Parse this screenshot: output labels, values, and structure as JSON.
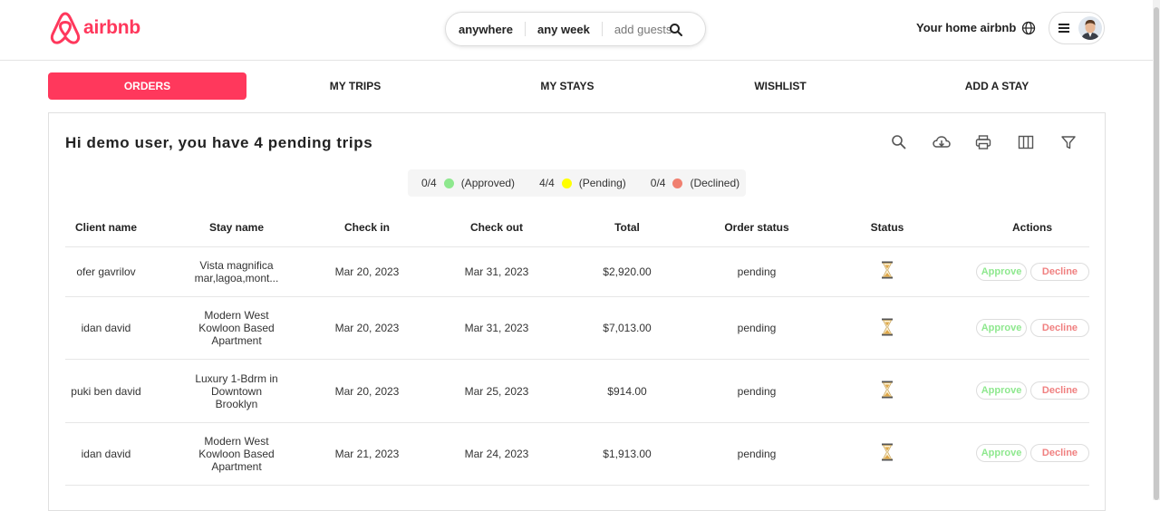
{
  "header": {
    "logo_text": "airbnb",
    "search": {
      "where": "anywhere",
      "when": "any week",
      "guests_placeholder": "add guests"
    },
    "host_link": "Your home airbnb"
  },
  "tabs": [
    {
      "label": "ORDERS",
      "active": true
    },
    {
      "label": "MY TRIPS",
      "active": false
    },
    {
      "label": "MY STAYS",
      "active": false
    },
    {
      "label": "WISHLIST",
      "active": false
    },
    {
      "label": "ADD A STAY",
      "active": false
    }
  ],
  "main": {
    "greeting": "Hi demo user, you have 4 pending trips",
    "toolbar_icons": [
      "search-icon",
      "cloud-download-icon",
      "print-icon",
      "columns-icon",
      "filter-icon"
    ],
    "summary": [
      {
        "count": "0/4",
        "label": "(Approved)",
        "color": "#8ee88e"
      },
      {
        "count": "4/4",
        "label": "(Pending)",
        "color": "#ffff00"
      },
      {
        "count": "0/4",
        "label": "(Declined)",
        "color": "#f08070"
      }
    ],
    "columns": [
      "Client name",
      "Stay name",
      "Check in",
      "Check out",
      "Total",
      "Order status",
      "Status",
      "Actions"
    ],
    "rows": [
      {
        "client": "ofer gavrilov",
        "stay": [
          "Vista magnifica",
          "mar,lagoa,mont..."
        ],
        "check_in": "Mar 20, 2023",
        "check_out": "Mar 31, 2023",
        "total": "$2,920.00",
        "order_status": "pending",
        "status_icon": "hourglass-icon"
      },
      {
        "client": "idan david",
        "stay": [
          "Modern West",
          "Kowloon Based",
          "Apartment"
        ],
        "check_in": "Mar 20, 2023",
        "check_out": "Mar 31, 2023",
        "total": "$7,013.00",
        "order_status": "pending",
        "status_icon": "hourglass-icon"
      },
      {
        "client": "puki ben david",
        "stay": [
          "Luxury 1-Bdrm in",
          "Downtown",
          "Brooklyn"
        ],
        "check_in": "Mar 20, 2023",
        "check_out": "Mar 25, 2023",
        "total": "$914.00",
        "order_status": "pending",
        "status_icon": "hourglass-icon"
      },
      {
        "client": "idan david",
        "stay": [
          "Modern West",
          "Kowloon Based",
          "Apartment"
        ],
        "check_in": "Mar 21, 2023",
        "check_out": "Mar 24, 2023",
        "total": "$1,913.00",
        "order_status": "pending",
        "status_icon": "hourglass-icon"
      }
    ],
    "actions": {
      "approve": "Approve",
      "decline": "Decline"
    }
  },
  "colors": {
    "brand": "#ff385c",
    "approve": "#8ee88e",
    "decline": "#f08080"
  }
}
